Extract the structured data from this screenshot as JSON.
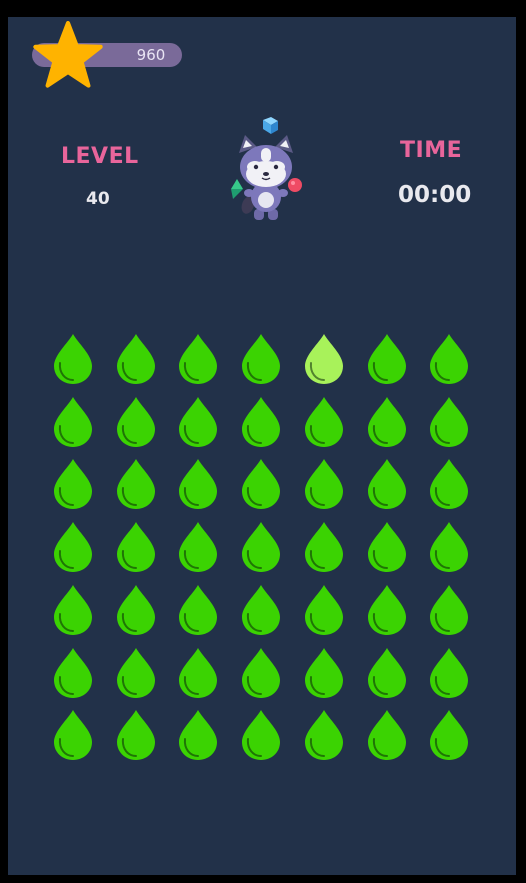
{
  "score": {
    "value": "960",
    "icon": "star-icon"
  },
  "level": {
    "label": "LEVEL",
    "value": "40"
  },
  "time": {
    "label": "TIME",
    "value": "00:00"
  },
  "mascot": {
    "icon": "raccoon-mascot-icon"
  },
  "grid": {
    "rows": 7,
    "cols": 7,
    "cell_icon": "water-drop-icon",
    "normal_color": "#3bd302",
    "highlight_color": "#a8f25a",
    "highlighted": [
      {
        "row": 0,
        "col": 4
      }
    ]
  },
  "colors": {
    "background": "#223149",
    "accent_label": "#e9659b",
    "score_pill": "#7a6a99",
    "star": "#ffb300"
  }
}
